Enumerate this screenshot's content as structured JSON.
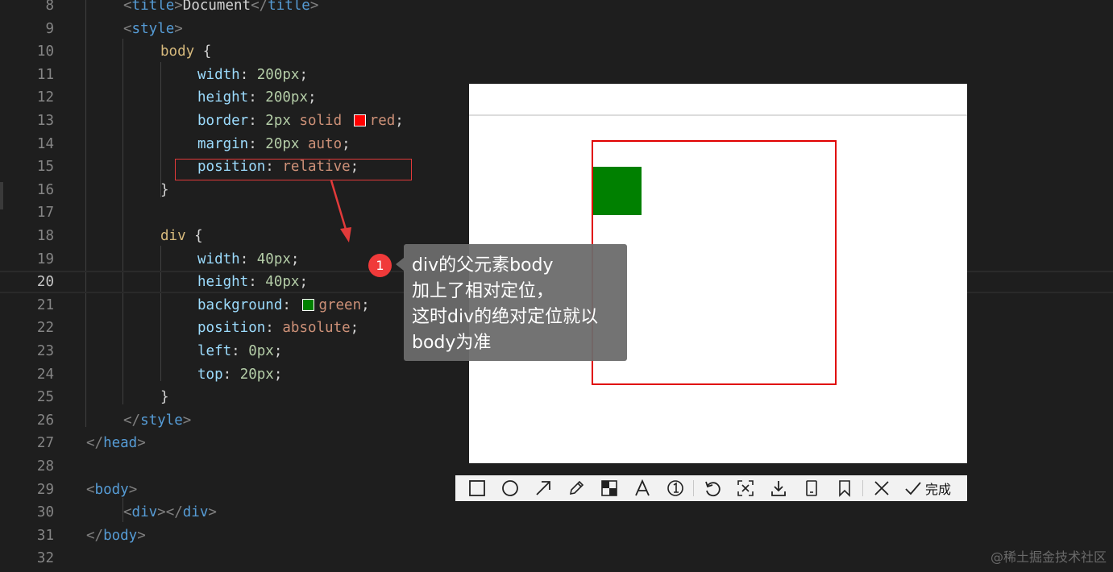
{
  "editor": {
    "lines": [
      {
        "n": "8",
        "parts": [
          {
            "c": "punc",
            "t": "<"
          },
          {
            "c": "tag",
            "t": "title"
          },
          {
            "c": "punc",
            "t": ">"
          },
          {
            "c": "txt",
            "t": "Document"
          },
          {
            "c": "punc",
            "t": "</"
          },
          {
            "c": "tag",
            "t": "title"
          },
          {
            "c": "punc",
            "t": ">"
          }
        ]
      },
      {
        "n": "9",
        "parts": [
          {
            "c": "punc",
            "t": "<"
          },
          {
            "c": "tag",
            "t": "style"
          },
          {
            "c": "punc",
            "t": ">"
          }
        ]
      },
      {
        "n": "10",
        "parts": [
          {
            "c": "sel",
            "t": "body"
          },
          {
            "c": "plain",
            "t": " {"
          }
        ]
      },
      {
        "n": "11",
        "parts": [
          {
            "c": "prop",
            "t": "width"
          },
          {
            "c": "plain",
            "t": ": "
          },
          {
            "c": "num",
            "t": "200px"
          },
          {
            "c": "plain",
            "t": ";"
          }
        ]
      },
      {
        "n": "12",
        "parts": [
          {
            "c": "prop",
            "t": "height"
          },
          {
            "c": "plain",
            "t": ": "
          },
          {
            "c": "num",
            "t": "200px"
          },
          {
            "c": "plain",
            "t": ";"
          }
        ]
      },
      {
        "n": "13",
        "parts": [
          {
            "c": "prop",
            "t": "border"
          },
          {
            "c": "plain",
            "t": ": "
          },
          {
            "c": "num",
            "t": "2px"
          },
          {
            "c": "val",
            "t": " solid "
          },
          {
            "c": "swatch",
            "t": "#ff0000"
          },
          {
            "c": "val",
            "t": "red"
          },
          {
            "c": "plain",
            "t": ";"
          }
        ]
      },
      {
        "n": "14",
        "parts": [
          {
            "c": "prop",
            "t": "margin"
          },
          {
            "c": "plain",
            "t": ": "
          },
          {
            "c": "num",
            "t": "20px"
          },
          {
            "c": "val",
            "t": " auto"
          },
          {
            "c": "plain",
            "t": ";"
          }
        ]
      },
      {
        "n": "15",
        "parts": [
          {
            "c": "prop",
            "t": "position"
          },
          {
            "c": "plain",
            "t": ": "
          },
          {
            "c": "val",
            "t": "relative"
          },
          {
            "c": "plain",
            "t": ";"
          }
        ]
      },
      {
        "n": "16",
        "parts": [
          {
            "c": "plain",
            "t": "}"
          }
        ]
      },
      {
        "n": "17",
        "parts": []
      },
      {
        "n": "18",
        "parts": [
          {
            "c": "sel",
            "t": "div"
          },
          {
            "c": "plain",
            "t": " {"
          }
        ]
      },
      {
        "n": "19",
        "parts": [
          {
            "c": "prop",
            "t": "width"
          },
          {
            "c": "plain",
            "t": ": "
          },
          {
            "c": "num",
            "t": "40px"
          },
          {
            "c": "plain",
            "t": ";"
          }
        ]
      },
      {
        "n": "20",
        "parts": [
          {
            "c": "prop",
            "t": "height"
          },
          {
            "c": "plain",
            "t": ": "
          },
          {
            "c": "num",
            "t": "40px"
          },
          {
            "c": "plain",
            "t": ";"
          }
        ]
      },
      {
        "n": "21",
        "parts": [
          {
            "c": "prop",
            "t": "background"
          },
          {
            "c": "plain",
            "t": ": "
          },
          {
            "c": "swatch",
            "t": "#008000"
          },
          {
            "c": "val",
            "t": "green"
          },
          {
            "c": "plain",
            "t": ";"
          }
        ]
      },
      {
        "n": "22",
        "parts": [
          {
            "c": "prop",
            "t": "position"
          },
          {
            "c": "plain",
            "t": ": "
          },
          {
            "c": "val",
            "t": "absolute"
          },
          {
            "c": "plain",
            "t": ";"
          }
        ]
      },
      {
        "n": "23",
        "parts": [
          {
            "c": "prop",
            "t": "left"
          },
          {
            "c": "plain",
            "t": ": "
          },
          {
            "c": "num",
            "t": "0px"
          },
          {
            "c": "plain",
            "t": ";"
          }
        ]
      },
      {
        "n": "24",
        "parts": [
          {
            "c": "prop",
            "t": "top"
          },
          {
            "c": "plain",
            "t": ": "
          },
          {
            "c": "num",
            "t": "20px"
          },
          {
            "c": "plain",
            "t": ";"
          }
        ]
      },
      {
        "n": "25",
        "parts": [
          {
            "c": "plain",
            "t": "}"
          }
        ]
      },
      {
        "n": "26",
        "parts": [
          {
            "c": "punc",
            "t": "</"
          },
          {
            "c": "tag",
            "t": "style"
          },
          {
            "c": "punc",
            "t": ">"
          }
        ]
      },
      {
        "n": "27",
        "parts": [
          {
            "c": "punc",
            "t": "</"
          },
          {
            "c": "tag",
            "t": "head"
          },
          {
            "c": "punc",
            "t": ">"
          }
        ]
      },
      {
        "n": "28",
        "parts": []
      },
      {
        "n": "29",
        "parts": [
          {
            "c": "punc",
            "t": "<"
          },
          {
            "c": "tag",
            "t": "body"
          },
          {
            "c": "punc",
            "t": ">"
          }
        ]
      },
      {
        "n": "30",
        "parts": [
          {
            "c": "punc",
            "t": "<"
          },
          {
            "c": "tag",
            "t": "div"
          },
          {
            "c": "punc",
            "t": "></"
          },
          {
            "c": "tag",
            "t": "div"
          },
          {
            "c": "punc",
            "t": ">"
          }
        ]
      },
      {
        "n": "31",
        "parts": [
          {
            "c": "punc",
            "t": "</"
          },
          {
            "c": "tag",
            "t": "body"
          },
          {
            "c": "punc",
            "t": ">"
          }
        ]
      },
      {
        "n": "32",
        "parts": []
      }
    ],
    "current_line": "20"
  },
  "annotation": {
    "badge": "1",
    "lines": [
      "div的父元素body",
      "加上了相对定位，",
      "这时div的绝对定位就以",
      "body为准"
    ]
  },
  "toolbar": {
    "tools": [
      "rectangle-icon",
      "circle-icon",
      "arrow-icon",
      "pen-icon",
      "mosaic-icon",
      "text-icon",
      "number-icon",
      "undo-icon",
      "ocr-icon",
      "download-icon",
      "pin-icon",
      "bookmark-icon",
      "close-icon"
    ],
    "done_label": "完成"
  },
  "watermark": "@稀土掘金技术社区",
  "colors": {
    "accent_red": "#e00000",
    "green_box": "#008000"
  }
}
